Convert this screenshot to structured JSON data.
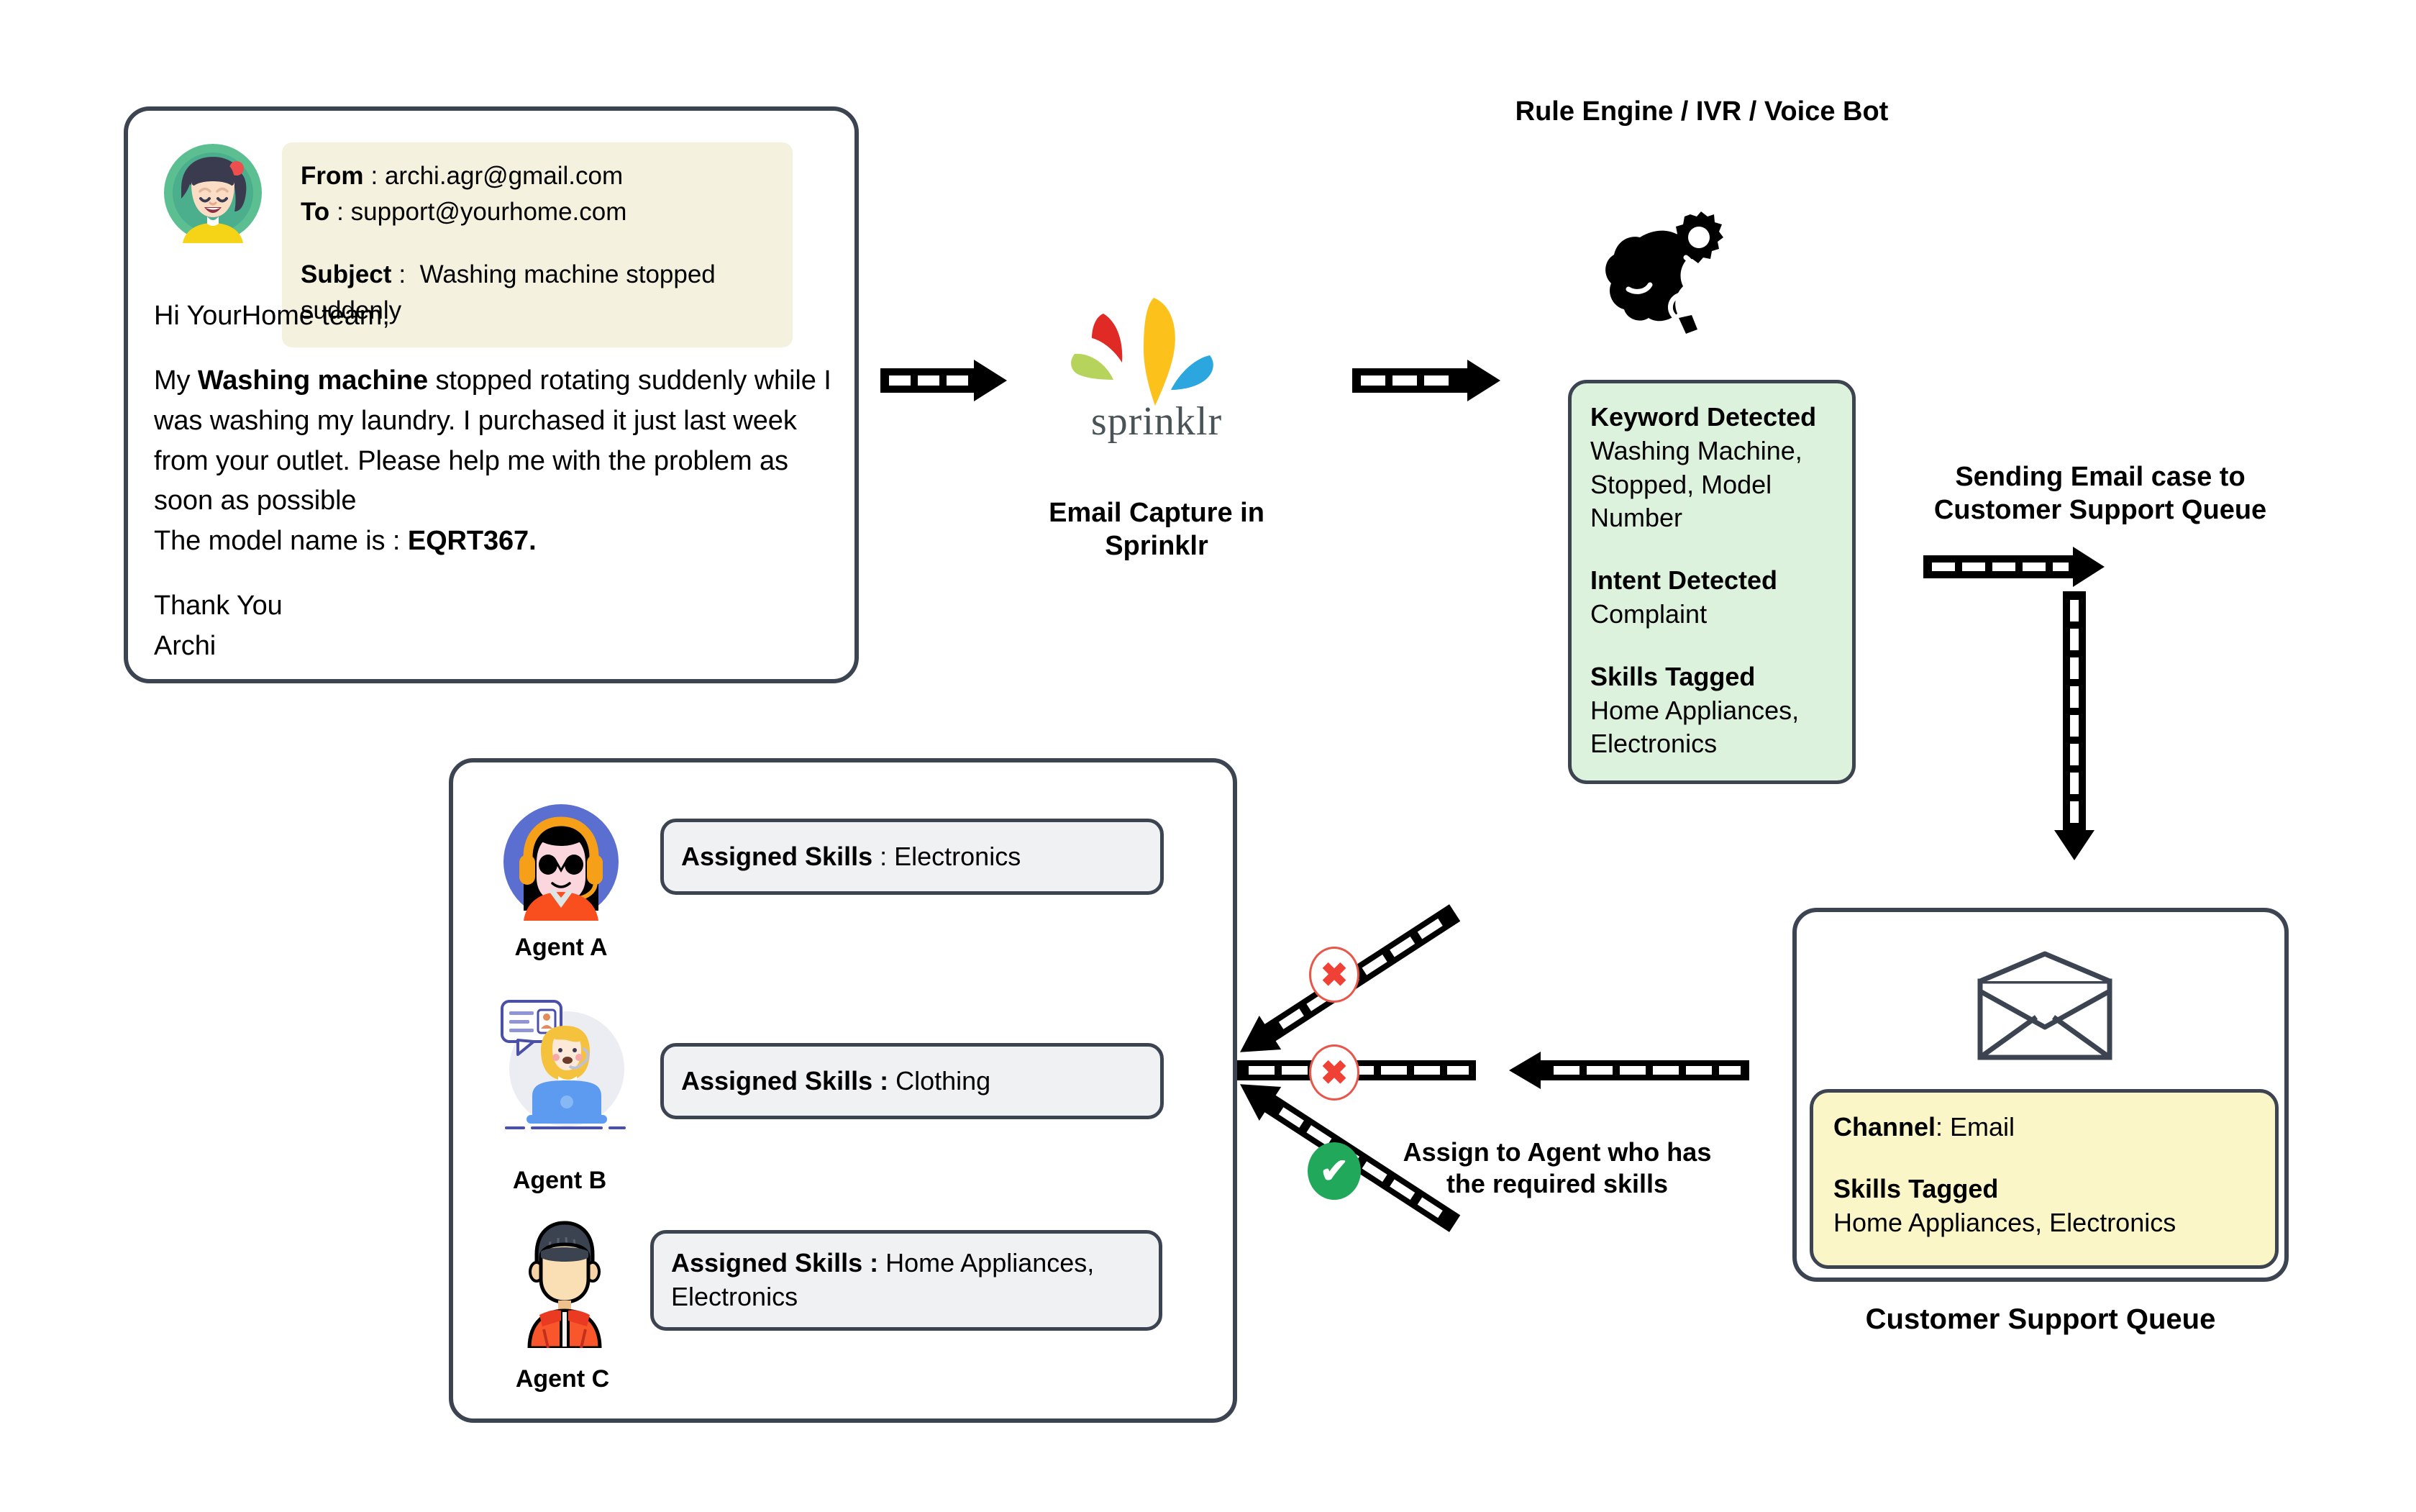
{
  "email_card": {
    "avatar_icon": "girl-avatar-icon",
    "from_label": "From",
    "from_sep": ":",
    "from_value": "archi.agr@gmail.com",
    "to_label": "To",
    "to_sep": ":",
    "to_value": "support@yourhome.com",
    "subject_label": "Subject",
    "subject_sep": ":",
    "subject_value": "Washing machine stopped suddenly",
    "greeting": "Hi YourHome team,",
    "body_pre": "My ",
    "body_bold": "Washing machine",
    "body_post": " stopped rotating suddenly while I was washing my laundry. I purchased it just last week from your outlet. Please help me with the problem as soon as possible",
    "model_label": "The model name is : ",
    "model_value": "EQRT367.",
    "signoff": "Thank You",
    "signer": "Archi"
  },
  "sprinklr": {
    "logo_icon": "sprinklr-logo-icon",
    "wordmark": "sprinklr",
    "caption": "Email Capture in Sprinklr"
  },
  "rule_engine": {
    "caption": "Rule Engine / IVR / Voice Bot",
    "icon": "brain-gear-icon",
    "keyword_label": "Keyword Detected",
    "keyword_value": "Washing Machine, Stopped, Model Number",
    "intent_label": "Intent Detected",
    "intent_value": "Complaint",
    "skills_label": "Skills Tagged",
    "skills_value": "Home Appliances, Electronics"
  },
  "routing": {
    "send_caption": "Sending Email case to Customer Support Queue",
    "assign_caption": "Assign to Agent who has the required skills",
    "reject_badge": "✖",
    "accept_badge": "✔"
  },
  "queue": {
    "envelope_icon": "envelope-icon",
    "channel_label": "Channel",
    "channel_sep": ": ",
    "channel_value": "Email",
    "skills_label": "Skills Tagged",
    "skills_value": "Home Appliances, Electronics",
    "caption": "Customer Support Queue"
  },
  "agents": [
    {
      "name": "Agent A",
      "avatar_icon": "agent-headset-female-icon",
      "skills_label": "Assigned Skills",
      "skills_sep": " : ",
      "skills_value": "Electronics",
      "match": "reject"
    },
    {
      "name": "Agent B",
      "avatar_icon": "agent-laptop-female-icon",
      "skills_label": "Assigned Skills :",
      "skills_sep": " ",
      "skills_value": "Clothing",
      "match": "reject"
    },
    {
      "name": "Agent C",
      "avatar_icon": "agent-male-icon",
      "skills_label": "Assigned Skills :",
      "skills_sep": " ",
      "skills_value": "Home Appliances, Electronics",
      "match": "accept"
    }
  ],
  "colors": {
    "outline": "#3d4451",
    "cream": "#f4f1de",
    "green": "#ddf2dc",
    "yellow": "#fbf6c8",
    "grey": "#f0f1f3",
    "reject": "#ef4136",
    "accept": "#21a85a"
  }
}
